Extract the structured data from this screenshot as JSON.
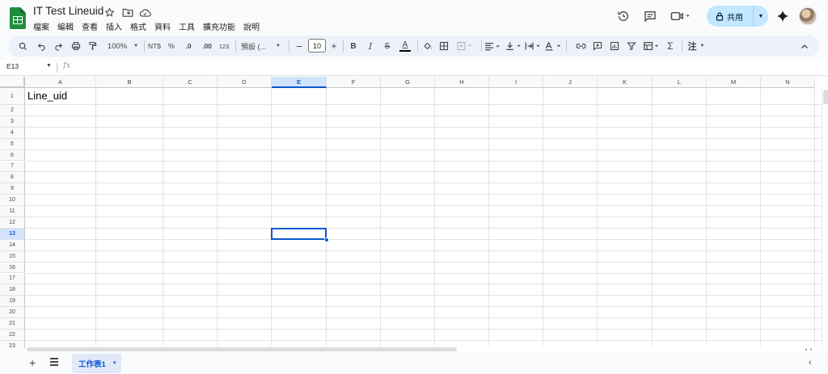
{
  "header": {
    "doc_title": "IT Test Lineuid",
    "menus": [
      "檔案",
      "編輯",
      "查看",
      "插入",
      "格式",
      "資料",
      "工具",
      "擴充功能",
      "說明"
    ],
    "share_label": "共用"
  },
  "toolbar": {
    "zoom": "100%",
    "currency": "NT$",
    "percent": "%",
    "decrease_decimal": ".0",
    "increase_decimal": ".00",
    "number_format": "123",
    "font_name": "預設 (...",
    "font_size": "10",
    "bold": "B",
    "italic": "I",
    "strikethrough": "S",
    "text_color": "A",
    "function": "Σ",
    "input_tools": "注"
  },
  "formula_bar": {
    "name_box": "E13",
    "fx": "fx",
    "content": ""
  },
  "grid": {
    "columns": [
      "A",
      "B",
      "C",
      "D",
      "E",
      "F",
      "G",
      "H",
      "I",
      "J",
      "K",
      "L",
      "M",
      "N"
    ],
    "selected_column": "E",
    "rows": [
      "1",
      "2",
      "3",
      "4",
      "5",
      "6",
      "7",
      "8",
      "9",
      "10",
      "11",
      "12",
      "13",
      "14",
      "15",
      "16",
      "17",
      "18",
      "19",
      "20",
      "21",
      "22",
      "23"
    ],
    "selected_row": "13",
    "cells": {
      "A1": "Line_uid"
    },
    "selected_cell": "E13"
  },
  "sheets": {
    "tabs": [
      {
        "label": "工作表1",
        "active": true
      }
    ]
  },
  "colors": {
    "accent": "#0b57d0",
    "share_bg": "#c2e7ff",
    "sheets_green": "#1e8e3e"
  }
}
